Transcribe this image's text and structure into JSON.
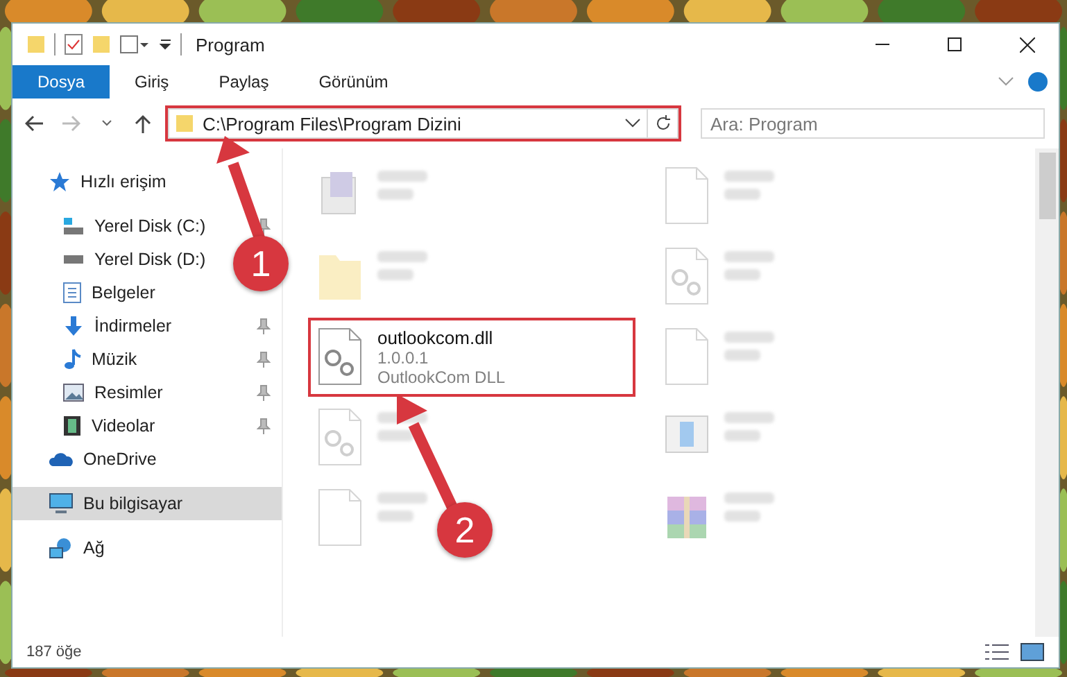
{
  "window": {
    "title": "Program"
  },
  "ribbon_tabs": [
    {
      "label": "Dosya",
      "selected": true
    },
    {
      "label": "Giriş",
      "selected": false
    },
    {
      "label": "Paylaş",
      "selected": false
    },
    {
      "label": "Görünüm",
      "selected": false
    }
  ],
  "address": {
    "path": "C:\\Program Files\\Program Dizini",
    "highlighted": true
  },
  "search": {
    "placeholder": "Ara: Program"
  },
  "sidebar": [
    {
      "label": "Hızlı erişim",
      "kind": "star",
      "selected": false,
      "children": [
        {
          "label": "Yerel Disk (C:)",
          "kind": "windisk",
          "pinned": true,
          "selected": false
        },
        {
          "label": "Yerel Disk (D:)",
          "kind": "disk",
          "pinned": false,
          "selected": false
        },
        {
          "label": "Belgeler",
          "kind": "docs",
          "pinned": false,
          "selected": false
        },
        {
          "label": "İndirmeler",
          "kind": "download",
          "pinned": true,
          "selected": false
        },
        {
          "label": "Müzik",
          "kind": "music",
          "pinned": true,
          "selected": false
        },
        {
          "label": "Resimler",
          "kind": "pictures",
          "pinned": true,
          "selected": false
        },
        {
          "label": "Videolar",
          "kind": "videos",
          "pinned": true,
          "selected": false
        }
      ]
    },
    {
      "label": "OneDrive",
      "kind": "cloud",
      "selected": false
    },
    {
      "label": "Bu bilgisayar",
      "kind": "pc",
      "selected": true
    },
    {
      "label": "Ağ",
      "kind": "network",
      "selected": false
    }
  ],
  "files": [
    {
      "kind": "exe",
      "faded": true,
      "highlighted": false
    },
    {
      "kind": "blank",
      "faded": true,
      "highlighted": false
    },
    {
      "kind": "folder",
      "faded": true,
      "highlighted": false
    },
    {
      "kind": "dll",
      "faded": true,
      "highlighted": false
    },
    {
      "name": "outlookcom.dll",
      "lines": [
        "1.0.0.1",
        "OutlookCom DLL"
      ],
      "kind": "dll",
      "faded": false,
      "highlighted": true
    },
    {
      "kind": "blank",
      "faded": true,
      "highlighted": false
    },
    {
      "kind": "dll",
      "faded": true,
      "highlighted": false
    },
    {
      "kind": "installer",
      "faded": true,
      "highlighted": false
    },
    {
      "kind": "blank",
      "faded": true,
      "highlighted": false
    },
    {
      "kind": "archive",
      "faded": true,
      "highlighted": false
    }
  ],
  "callouts": [
    {
      "number": "1"
    },
    {
      "number": "2"
    }
  ],
  "status_bar": {
    "count": "187 öğe"
  }
}
